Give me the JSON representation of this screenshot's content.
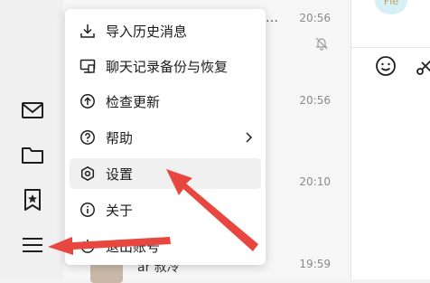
{
  "chat_list": {
    "times": [
      "20:56",
      "20:56",
      "20:10",
      "19:59"
    ],
    "peek_name": "ar 叔冷"
  },
  "right_pane": {
    "avatar_text": "Fle"
  },
  "menu": {
    "items": [
      {
        "label": "导入历史消息",
        "icon": "import-icon"
      },
      {
        "label": "聊天记录备份与恢复",
        "icon": "backup-icon"
      },
      {
        "label": "检查更新",
        "icon": "update-icon"
      },
      {
        "label": "帮助",
        "icon": "help-icon",
        "has_submenu": true
      },
      {
        "label": "设置",
        "icon": "settings-icon",
        "highlighted": true
      },
      {
        "label": "关于",
        "icon": "info-icon"
      },
      {
        "label": "退出账号",
        "icon": "power-icon"
      }
    ]
  },
  "colors": {
    "annotation_arrow": "#e8473f",
    "menu_bg": "#ffffff",
    "highlight_bg": "#f0f0f0"
  }
}
